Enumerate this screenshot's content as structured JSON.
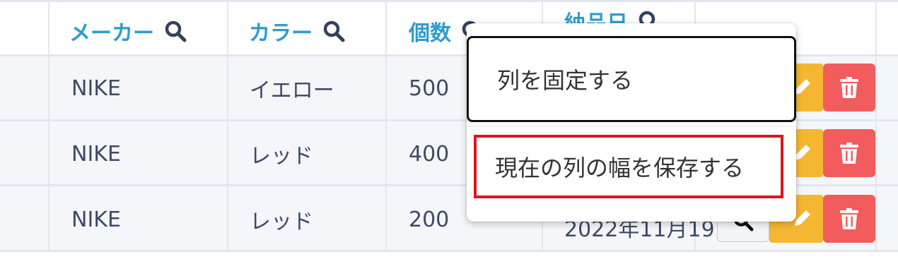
{
  "table": {
    "headers": [
      {
        "label": "メーカー",
        "icon": "search-icon"
      },
      {
        "label": "カラー",
        "icon": "search-icon"
      },
      {
        "label": "個数",
        "icon": "search-icon"
      },
      {
        "label": "納品日",
        "icon": "search-icon"
      }
    ],
    "rows": [
      {
        "maker": "NIKE",
        "color": "イエロー",
        "qty": "500",
        "date": ""
      },
      {
        "maker": "NIKE",
        "color": "レッド",
        "qty": "400",
        "date": ""
      },
      {
        "maker": "NIKE",
        "color": "レッド",
        "qty": "200",
        "date": "2022年11月19"
      }
    ],
    "row_actions": [
      {
        "icon": "pencil-icon",
        "color": "#f5b731"
      },
      {
        "icon": "trash-icon",
        "color": "#f25c5c"
      }
    ],
    "date_picker_icon": "search-icon"
  },
  "context_menu": {
    "items": [
      {
        "label": "列を固定する"
      },
      {
        "label": "現在の列の幅を保存する",
        "highlighted": true
      }
    ]
  },
  "colors": {
    "header_text": "#2e9ccc",
    "body_text": "#3d4a66",
    "grid": "#e3e6ef",
    "row_background": "#f5f6fa",
    "highlight_border": "#e0141d"
  }
}
